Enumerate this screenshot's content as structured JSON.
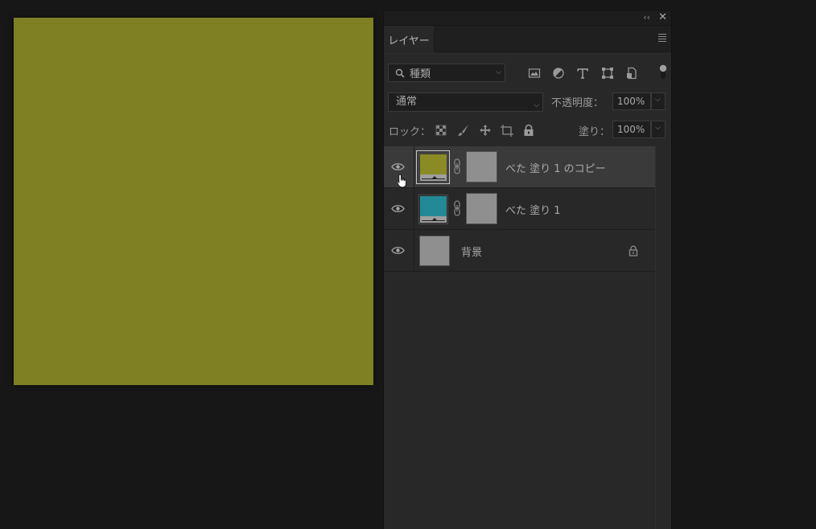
{
  "colors": {
    "canvas_fill": "#7f7f24",
    "fill_copy_color": "#8b8b25",
    "fill_1_color": "#238996"
  },
  "panel": {
    "tab_label": "レイヤー",
    "collapse_icon": "double-chevron-left-icon",
    "close_icon": "close-icon",
    "menu_icon": "panel-menu-icon"
  },
  "filter": {
    "kind_label": "種類",
    "icons": [
      "image-filter-icon",
      "adjustment-filter-icon",
      "type-filter-icon",
      "shape-filter-icon",
      "smart-object-filter-icon"
    ]
  },
  "blend": {
    "mode": "通常",
    "opacity_label": "不透明度：",
    "opacity_value": "100%"
  },
  "lock": {
    "label": "ロック：",
    "fill_label": "塗り：",
    "fill_value": "100%"
  },
  "layers": [
    {
      "name": "べた 塗り 1 のコピー",
      "selected": true
    },
    {
      "name": "べた 塗り 1",
      "selected": false
    },
    {
      "name": "背景",
      "selected": false,
      "locked": true
    }
  ]
}
